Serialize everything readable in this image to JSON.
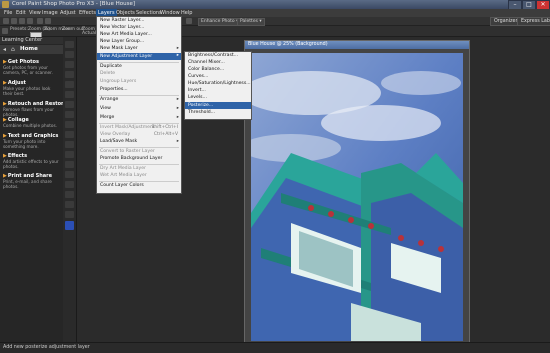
{
  "titlebar": {
    "title": "Corel Paint Shop Photo Pro X3 - [Blue House]",
    "minimize_glyph": "–",
    "maximize_glyph": "□",
    "close_glyph": "✕"
  },
  "menubar": [
    "File",
    "Edit",
    "View",
    "Image",
    "Adjust",
    "Effects",
    "Layers",
    "Objects",
    "Selections",
    "Window",
    "Help"
  ],
  "menubar_active": "Layers",
  "toolbar1": {
    "enhance_photo": "Enhance Photo ▾",
    "palettes": "Palettes ▾"
  },
  "toolbar2": {
    "presets": "Presets:",
    "zoom_pct": "Zoom (%):",
    "zoom_more": "Zoom more:",
    "zoom_out": "Zoom out:",
    "zoom_in_label": "Zoom in/",
    "actual_size": "Actual size"
  },
  "right_buttons": {
    "organizer": "Organizer",
    "express_lab": "Express Lab"
  },
  "learning_center": {
    "title": "Learning Center",
    "home": "Home",
    "items": [
      {
        "title": "Get Photos",
        "desc": "Get photos from your camera, PC, or scanner."
      },
      {
        "title": "Adjust",
        "desc": "Make your photos look their best."
      },
      {
        "title": "Retouch and Restore",
        "desc": "Remove flaws from your photos."
      },
      {
        "title": "Collage",
        "desc": "Combine multiple photos."
      },
      {
        "title": "Text and Graphics",
        "desc": "Turn your photo into something more."
      },
      {
        "title": "Effects",
        "desc": "Add artistic effects to your photos."
      },
      {
        "title": "Print and Share",
        "desc": "Print, e-mail, and share photos."
      }
    ]
  },
  "layers_menu": {
    "items": [
      {
        "label": "New Raster Layer...",
        "shortcut": "",
        "disabled": false
      },
      {
        "label": "New Vector Layer...",
        "shortcut": "",
        "disabled": false
      },
      {
        "label": "New Art Media Layer...",
        "shortcut": "",
        "disabled": false
      },
      {
        "label": "New Layer Group...",
        "shortcut": "",
        "disabled": false
      },
      {
        "label": "New Mask Layer",
        "shortcut": "",
        "disabled": false,
        "submenu": true
      },
      {
        "label": "New Adjustment Layer",
        "shortcut": "",
        "disabled": false,
        "submenu": true,
        "highlighted": true
      },
      {
        "label": "Duplicate",
        "shortcut": "",
        "disabled": false
      },
      {
        "label": "Delete",
        "shortcut": "",
        "disabled": true
      },
      {
        "label": "Ungroup Layers",
        "shortcut": "",
        "disabled": true
      },
      {
        "label": "Properties...",
        "shortcut": "",
        "disabled": false
      },
      {
        "label": "Arrange",
        "shortcut": "",
        "disabled": false,
        "submenu": true
      },
      {
        "label": "View",
        "shortcut": "",
        "disabled": false,
        "submenu": true
      },
      {
        "label": "Merge",
        "shortcut": "",
        "disabled": false,
        "submenu": true
      },
      {
        "label": "Invert Mask/Adjustment",
        "shortcut": "Shift+Ctrl+I",
        "disabled": true
      },
      {
        "label": "View Overlay",
        "shortcut": "Ctrl+Alt+V",
        "disabled": true
      },
      {
        "label": "Load/Save Mask",
        "shortcut": "",
        "disabled": false,
        "submenu": true
      },
      {
        "label": "Convert to Raster Layer",
        "shortcut": "",
        "disabled": true
      },
      {
        "label": "Promote Background Layer",
        "shortcut": "",
        "disabled": false
      },
      {
        "label": "Dry Art Media Layer",
        "shortcut": "",
        "disabled": true
      },
      {
        "label": "Wet Art Media Layer",
        "shortcut": "",
        "disabled": true
      },
      {
        "label": "Count Layer Colors",
        "shortcut": "",
        "disabled": false
      }
    ]
  },
  "adjustment_submenu": {
    "items": [
      {
        "label": "Brightness/Contrast...",
        "highlighted": false
      },
      {
        "label": "Channel Mixer...",
        "highlighted": false
      },
      {
        "label": "Color Balance...",
        "highlighted": false
      },
      {
        "label": "Curves...",
        "highlighted": false
      },
      {
        "label": "Hue/Saturation/Lightness...",
        "highlighted": false
      },
      {
        "label": "Invert...",
        "highlighted": false
      },
      {
        "label": "Levels...",
        "highlighted": false
      },
      {
        "label": "Posterize...",
        "highlighted": true
      },
      {
        "label": "Threshold...",
        "highlighted": false
      }
    ]
  },
  "image_window": {
    "title": "Blue House @ 25% (Background)"
  },
  "statusbar": {
    "text": "Add new posterize adjustment layer"
  },
  "colors": {
    "menu_highlight": "#2e63a8",
    "learning_arrow": "#e9a23b",
    "house_teal": "#2aa59a",
    "house_blue": "#3f66b0"
  }
}
